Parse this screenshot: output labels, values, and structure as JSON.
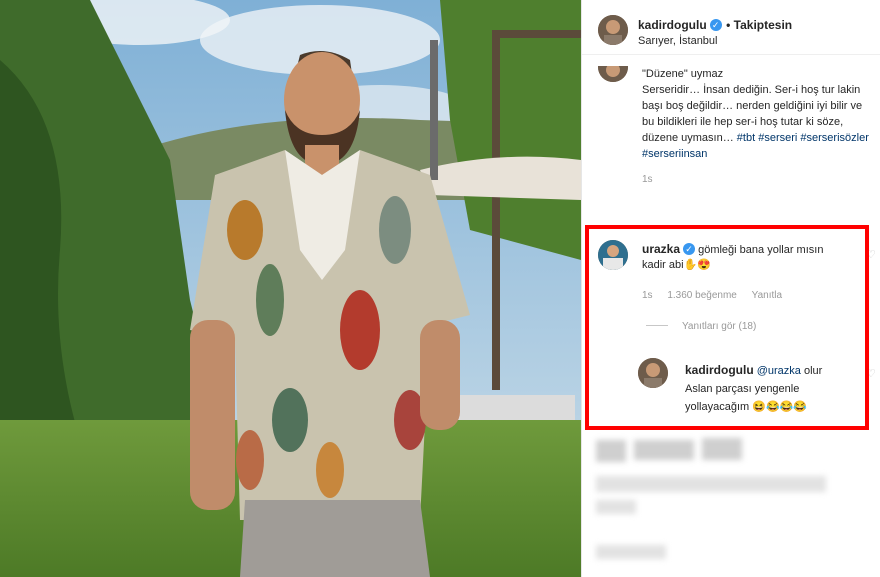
{
  "post": {
    "username": "kadirdogulu",
    "follow_status": "• Takiptesin",
    "location": "Sarıyer, İstanbul"
  },
  "caption": {
    "line1": "\"Düzene\" uymaz",
    "body": "Serseridir… İnsan dediğin. Ser-i hoş tur lakin başı boş değildir… nerden geldiğini iyi bilir ve bu bildikleri ile hep ser-i hoş tutar ki söze, düzene uymasın… ",
    "tags": [
      "#tbt",
      "#serseri",
      "#serserisözler",
      "#serseriinsan"
    ],
    "time": "1s"
  },
  "comment": {
    "username": "urazka",
    "text": "gömleği bana yollar mısın kadir abi✋😍",
    "time": "1s",
    "likes": "1.360 beğenme",
    "reply_label": "Yanıtla",
    "view_replies": "Yanıtları gör (18)"
  },
  "reply": {
    "username": "kadirdogulu",
    "mention": "@urazka",
    "text": " olur Aslan parçası yengenle yollayacağım 😆😂😂😂"
  },
  "colors": {
    "highlight": "#ff0000",
    "verified": "#3897f0",
    "hashtag": "#003569"
  }
}
